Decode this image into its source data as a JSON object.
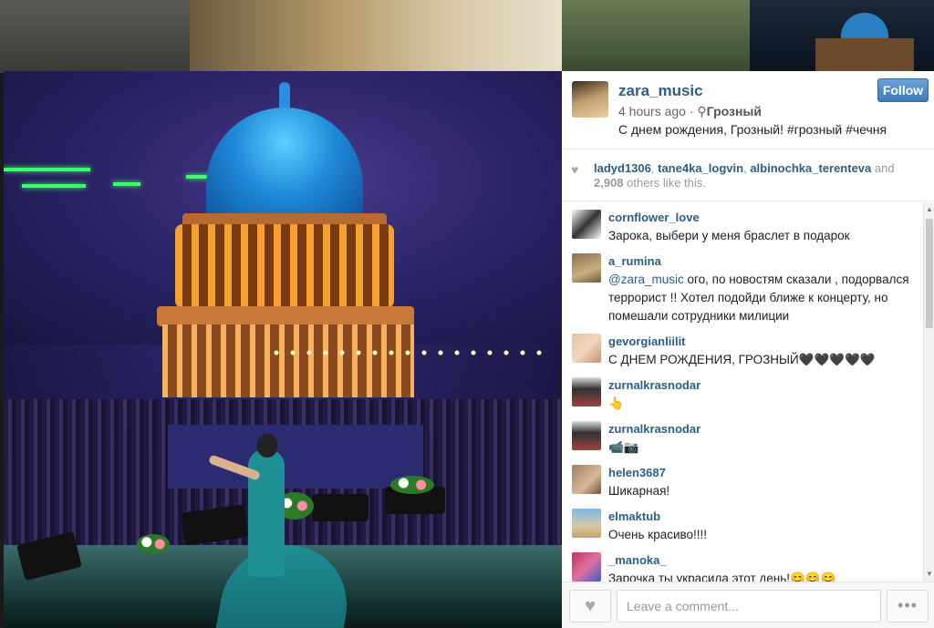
{
  "post": {
    "username": "zara_music",
    "time": "4 hours ago",
    "separator": "·",
    "location_icon": "location-pin-icon",
    "location": "Грозный",
    "caption": "С днем рождения, Грозный! #грозный #чечня",
    "follow_label": "Follow"
  },
  "likes": {
    "heart_icon": "heart-icon",
    "user1": "ladyd1306",
    "sep1": ",",
    "user2": "tane4ka_logvin",
    "sep2": ",",
    "user3": "albinochka_terenteva",
    "and": "and",
    "count": "2,908",
    "suffix": "others like this."
  },
  "comments": [
    {
      "user": "cornflower_love",
      "text": "Зарока, выбери у меня браслет в подарок"
    },
    {
      "user": "a_rumina",
      "mention": "@zara_music",
      "text": " ого, по новостям сказали , подорвался террорист !! Хотел подойди ближе к концерту, но помешали сотрудники милиции"
    },
    {
      "user": "gevorgianliilit",
      "text": "С ДНЕМ РОЖДЕНИЯ, ГРОЗНЫЙ🖤🖤🖤🖤🖤"
    },
    {
      "user": "zurnalkrasnodar",
      "text": "👆"
    },
    {
      "user": "zurnalkrasnodar",
      "text": "📹📷"
    },
    {
      "user": "helen3687",
      "text": "Шикарная!"
    },
    {
      "user": "elmaktub",
      "text": "Очень красиво!!!!"
    },
    {
      "user": "_manoka_",
      "text": "Зарочка ты украсила этот день!😊😊😊"
    }
  ],
  "footer": {
    "like_icon": "heart-icon",
    "comment_placeholder": "Leave a comment...",
    "more_icon": "ellipsis-icon",
    "more_label": "•••",
    "heart_glyph": "♥"
  },
  "colors": {
    "link": "#2e5e86",
    "follow_button": "#3f7ab8"
  }
}
